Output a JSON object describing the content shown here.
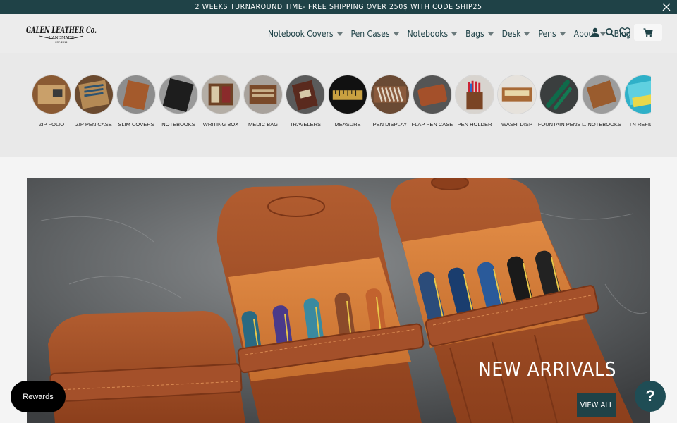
{
  "announcement": {
    "text": "2 WEEKS TURNAROUND TIME- FREE SHIPPING OVER 250$ WITH CODE SHIP25",
    "close_icon": "close-icon"
  },
  "brand": {
    "logo_text": "GALEN LEATHER Co.",
    "logo_subtext": "HANDMADE",
    "logo_est": "EST. 2012"
  },
  "nav": {
    "items": [
      {
        "label": "Notebook Covers",
        "dropdown": true
      },
      {
        "label": "Pen Cases",
        "dropdown": true
      },
      {
        "label": "Notebooks",
        "dropdown": true
      },
      {
        "label": "Bags",
        "dropdown": true
      },
      {
        "label": "Desk",
        "dropdown": true
      },
      {
        "label": "Pens",
        "dropdown": true
      },
      {
        "label": "About",
        "dropdown": true
      },
      {
        "label": "Blog",
        "dropdown": false
      }
    ],
    "icons": [
      "account-icon",
      "search-icon",
      "wishlist-heart-icon",
      "cart-icon"
    ]
  },
  "categories": [
    {
      "label": "ZIP FOLIO"
    },
    {
      "label": "ZIP PEN CASE"
    },
    {
      "label": "SLIM COVERS"
    },
    {
      "label": "NOTEBOOKS"
    },
    {
      "label": "WRITING BOX"
    },
    {
      "label": "MEDIC BAG"
    },
    {
      "label": "TRAVELERS"
    },
    {
      "label": "MEASURE"
    },
    {
      "label": "PEN DISPLAY"
    },
    {
      "label": "FLAP PEN CASE"
    },
    {
      "label": "PEN HOLDER"
    },
    {
      "label": "WASHI DISP"
    },
    {
      "label": "FOUNTAIN PENS"
    },
    {
      "label": "L. NOTEBOOKS"
    },
    {
      "label": "TN REFILLS"
    }
  ],
  "hero": {
    "title": "NEW ARRIVALS",
    "cta": "VIEW ALL"
  },
  "widgets": {
    "rewards_label": "Rewards",
    "help_label": "?"
  },
  "colors": {
    "brand_teal": "#1f4247",
    "leather": "#a4502a",
    "background": "#f4f4f4"
  }
}
